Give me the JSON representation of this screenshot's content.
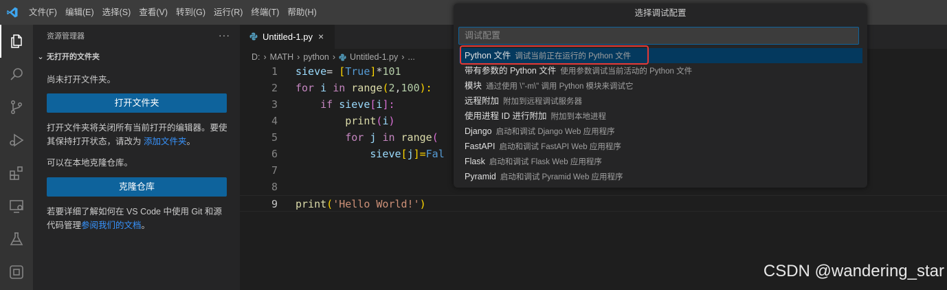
{
  "menubar": {
    "items": [
      "文件(F)",
      "编辑(E)",
      "选择(S)",
      "查看(V)",
      "转到(G)",
      "运行(R)",
      "终端(T)",
      "帮助(H)"
    ]
  },
  "activitybar": {
    "icons": [
      "explorer-icon",
      "search-icon",
      "source-control-icon",
      "run-debug-icon",
      "extensions-icon",
      "remote-explorer-icon",
      "testing-icon",
      "containers-icon"
    ]
  },
  "sidebar": {
    "header": "资源管理器",
    "more": "···",
    "section_title": "无打开的文件夹",
    "no_folder_text": "尚未打开文件夹。",
    "open_folder_button": "打开文件夹",
    "info_text": "打开文件夹将关闭所有当前打开的编辑器。要使其保持打开状态，请改为 ",
    "info_link": "添加文件夹",
    "info_end": "。",
    "clone_text": "可以在本地克隆仓库。",
    "clone_button": "克隆仓库",
    "learn_text": "若要详细了解如何在 VS Code 中使用 Git 和源代码管理",
    "learn_link": "参阅我们的文档",
    "learn_end": "。"
  },
  "editor": {
    "tab_label": "Untitled-1.py",
    "tab_close": "×",
    "breadcrumb": [
      "D:",
      "MATH",
      "python",
      "Untitled-1.py",
      "..."
    ],
    "line_numbers": [
      "1",
      "2",
      "3",
      "4",
      "5",
      "6",
      "7",
      "8",
      "9"
    ],
    "code": {
      "l1_a": "sieve",
      "l1_b": "= ",
      "l1_c": "[",
      "l1_d": "True",
      "l1_e": "]",
      "l1_f": "*",
      "l1_g": "101",
      "l2_a": "for",
      "l2_b": "i",
      "l2_c": "in",
      "l2_d": "range",
      "l2_e": "(",
      "l2_f": "2",
      "l2_g": ",",
      "l2_h": "100",
      "l2_i": "):",
      "l3_a": "if",
      "l3_b": "sieve",
      "l3_c": "[",
      "l3_d": "i",
      "l3_e": "]:",
      "l4_a": "print",
      "l4_b": "(",
      "l4_c": "i",
      "l4_d": ")",
      "l5_a": "for",
      "l5_b": "j",
      "l5_c": "in",
      "l5_d": "range",
      "l5_e": "(",
      "l6_a": "sieve",
      "l6_b": "[",
      "l6_c": "j",
      "l6_d": "]=",
      "l6_e": "Fal",
      "l9_a": "print",
      "l9_b": "(",
      "l9_c": "'Hello World!'",
      "l9_d": ")"
    }
  },
  "quickpick": {
    "title": "选择调试配置",
    "placeholder": "调试配置",
    "items": [
      {
        "label": "Python 文件",
        "desc": "调试当前正在运行的 Python 文件"
      },
      {
        "label": "带有参数的 Python 文件",
        "desc": "使用参数调试当前活动的 Python 文件"
      },
      {
        "label": "模块",
        "desc": "通过使用 \\\"-m\\\" 调用 Python 模块来调试它"
      },
      {
        "label": "远程附加",
        "desc": "附加到远程调试服务器"
      },
      {
        "label": "使用进程 ID 进行附加",
        "desc": "附加到本地进程"
      },
      {
        "label": "Django",
        "desc": "启动和调试 Django Web 应用程序"
      },
      {
        "label": "FastAPI",
        "desc": "启动和调试 FastAPI Web 应用程序"
      },
      {
        "label": "Flask",
        "desc": "启动和调试 Flask Web 应用程序"
      },
      {
        "label": "Pyramid",
        "desc": "启动和调试 Pyramid Web 应用程序"
      }
    ]
  },
  "watermark": "CSDN @wandering_star",
  "colors": {
    "accent": "#0e639c",
    "selection": "#04395e",
    "highlight_box": "#e53935"
  }
}
